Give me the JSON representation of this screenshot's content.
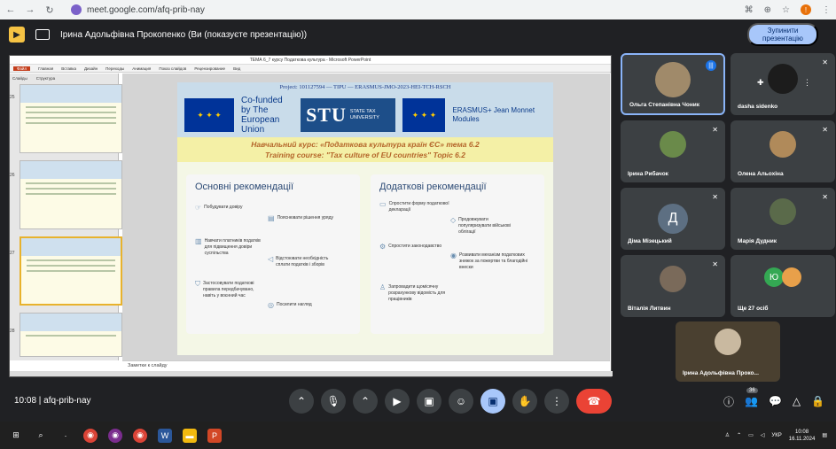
{
  "browser": {
    "url": "meet.google.com/afq-prib-nay"
  },
  "presentation": {
    "presenter_label": "Ірина Адольфівна Прокопенко (Ви (показуєте презентацію))",
    "stop_label": "Зупинити презентацію"
  },
  "ppt": {
    "window_title": "ТЕМА 6_7 курсу Податкова культура - Microsoft PowerPoint",
    "ribbon_tabs": [
      "Файл",
      "Главная",
      "Вставка",
      "Дизайн",
      "Переходы",
      "Анимация",
      "Показ слайдов",
      "Рецензирование",
      "Вид"
    ],
    "pane_tabs": [
      "Слайды",
      "Структура"
    ],
    "thumb_numbers": [
      "25",
      "26",
      "27",
      "28"
    ],
    "notes_placeholder": "Заметки к слайду"
  },
  "slide": {
    "project": "Project: 101127594 — TIPU — ERASMUS-JMO-2023-HEI-TCH-RSCH",
    "cofunded": "Co-funded by The European Union",
    "stu_big": "STU",
    "stu_small": "STATE TAX UNIVERSITY",
    "erasmus": "ERASMUS+ Jean Monnet Modules",
    "course_ua": "Навчальний курс: «Податкова культура країн ЄС» тема 6.2",
    "course_en": "Training course: \"Tax culture of EU countries\" Topic 6.2",
    "left_title": "Основні рекомендації",
    "left_items": [
      "Побудувати довіру",
      "Пояснювати рішення уряду",
      "Навчати платників податків для підвищення довіри суспільства",
      "Відстоювати необхідність сплати податків і зборів",
      "Застосовувати податкові правила передбачувано, навіть у воєнний час",
      "Посилити нагляд"
    ],
    "right_title": "Додаткові рекомендації",
    "right_items": [
      "Спростити форму податкової декларації",
      "Продовжувати популяризувати військові облігації",
      "Спростити законодавство",
      "Розвивати механізм податкових знижок за пожертви та благодійні внески",
      "Запровадити щомісячну розрахункову відомість для працівників"
    ]
  },
  "participants": [
    {
      "name": "Ольга Степанівна Чоник",
      "avatar": "photo"
    },
    {
      "name": "dasha sidenko",
      "avatar": "photo"
    },
    {
      "name": "Ірина Рибачок",
      "avatar": "photo"
    },
    {
      "name": "Олена Альохіна",
      "avatar": "photo"
    },
    {
      "name": "Діма Мізецький",
      "avatar": "letter",
      "letter": "Д"
    },
    {
      "name": "Марія Дудник",
      "avatar": "photo"
    },
    {
      "name": "Віталія Литвин",
      "avatar": "photo"
    },
    {
      "name": "Ще 27 осіб",
      "avatar": "group",
      "letter": "Ю"
    }
  ],
  "self_tile": {
    "name": "Ірина Адольфівна Проко..."
  },
  "meeting": {
    "time_code": "10:08 | afq-prib-nay",
    "participant_count": "36"
  },
  "taskbar": {
    "lang": "УКР",
    "time": "10:08",
    "date": "16.11.2024"
  }
}
